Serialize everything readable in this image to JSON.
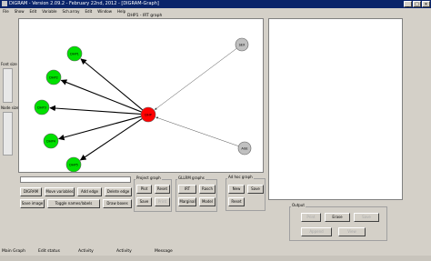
{
  "window": {
    "title": "DIGRAM - Version 2.09.2 - February 22nd, 2012 - [DIGRAM-Graph]"
  },
  "menu": [
    "File",
    "Show",
    "Edit",
    "Variable",
    "Sch.array",
    "Edit",
    "Window",
    "Help"
  ],
  "graph_title": "DHP1 - IRT graph",
  "left_labels": {
    "font_size": "Font size",
    "node_size": "Node size"
  },
  "graph": {
    "center": {
      "label": "DHP",
      "color": "#ff0000"
    },
    "items": [
      {
        "label": "DHP1",
        "color": "#00e000"
      },
      {
        "label": "DHP2",
        "color": "#00e000"
      },
      {
        "label": "DHP3",
        "color": "#00e000"
      },
      {
        "label": "DHP4",
        "color": "#00e000"
      },
      {
        "label": "DHP5",
        "color": "#00e000"
      }
    ],
    "exogenous": [
      {
        "label": "SEX",
        "color": "#c0c0c0"
      },
      {
        "label": "AGE",
        "color": "#c0c0c0"
      }
    ]
  },
  "buttons": {
    "digram": "DIGRAM",
    "move_variables": "Move variables",
    "add_edge": "Add edge",
    "delete_edge": "Delete edge",
    "save_image": "Save image",
    "toggle_names": "Toggle names/labels",
    "draw_boxes": "Draw boxes",
    "proj_plot": "Plot",
    "proj_reset": "Reset",
    "proj_save": "Save",
    "proj_dim1": "Print",
    "glrm_irt": "IRT",
    "glrm_rasch": "Rasch",
    "glrm_marginal": "Marginal",
    "glrm_model": "Model",
    "adhoc_new": "New",
    "adhoc_save": "Save",
    "adhoc_reset": "Reset",
    "out_print": "Print",
    "out_erase": "Erase",
    "out_save": "Save",
    "out_append": "Append",
    "out_view": "View"
  },
  "groups": {
    "project_graph": "Project graph",
    "glrm_graphs": "GLLRM graphs",
    "adhoc_graph": "Ad hoc graph",
    "output": "Output"
  },
  "status": {
    "main_graph": "Main Graph",
    "edit_status": "Edit status",
    "activity1": "Activity",
    "activity2": "Activity",
    "message": "Message"
  }
}
